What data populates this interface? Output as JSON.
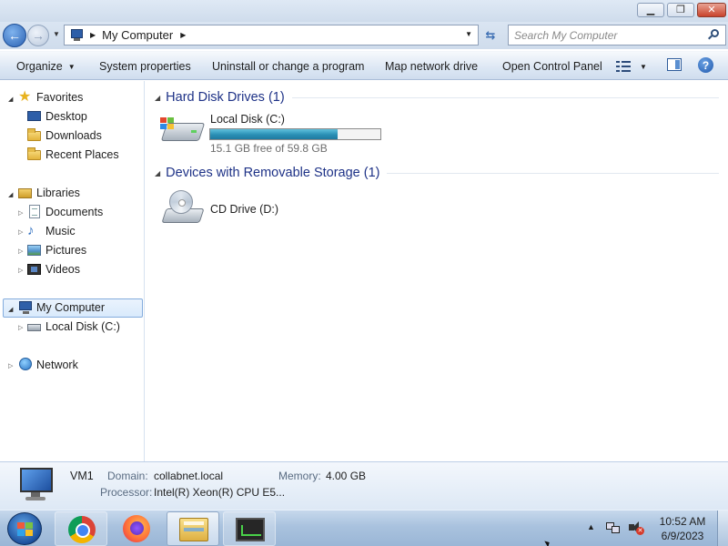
{
  "window": {
    "minimize_label": "▁",
    "maximize_label": "❐",
    "close_label": "✕"
  },
  "navbar": {
    "address_path": "My Computer",
    "search_placeholder": "Search My Computer"
  },
  "commandbar": {
    "organize": "Organize",
    "system_properties": "System properties",
    "uninstall": "Uninstall or change a program",
    "map_network_drive": "Map network drive",
    "open_control_panel": "Open Control Panel"
  },
  "navpane": {
    "favorites": "Favorites",
    "desktop": "Desktop",
    "downloads": "Downloads",
    "recent_places": "Recent Places",
    "libraries": "Libraries",
    "documents": "Documents",
    "music": "Music",
    "pictures": "Pictures",
    "videos": "Videos",
    "my_computer": "My Computer",
    "local_disk": "Local Disk (C:)",
    "network": "Network"
  },
  "content": {
    "hard_disk_header": "Hard Disk Drives (1)",
    "removable_header": "Devices with Removable Storage (1)",
    "local_disk_name": "Local Disk (C:)",
    "local_disk_free": "15.1 GB free of 59.8 GB",
    "local_disk_used_fraction": 0.748,
    "cd_drive_name": "CD Drive (D:)"
  },
  "details": {
    "computer_name": "VM1",
    "domain_label": "Domain:",
    "domain_value": "collabnet.local",
    "memory_label": "Memory:",
    "memory_value": "4.00 GB",
    "processor_label": "Processor:",
    "processor_value": "Intel(R) Xeon(R) CPU E5..."
  },
  "taskbar": {
    "time": "10:52 AM",
    "date": "6/9/2023"
  },
  "colors": {
    "group_header": "#1e3287",
    "usage_fill": "#2a8fb5",
    "selection_border": "#84acdd"
  }
}
